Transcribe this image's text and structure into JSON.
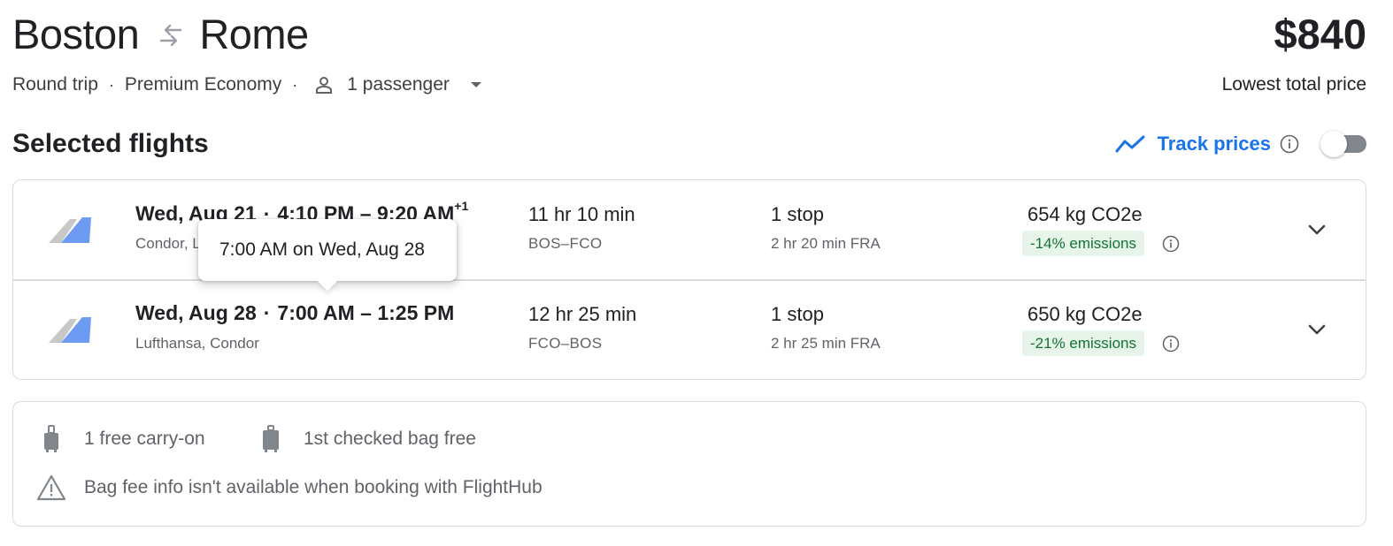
{
  "header": {
    "origin": "Boston",
    "destination": "Rome",
    "price": "$840",
    "price_caption": "Lowest total price",
    "trip_type": "Round trip",
    "cabin": "Premium Economy",
    "passengers": "1 passenger",
    "separator": "·"
  },
  "section": {
    "title": "Selected flights",
    "track_prices_label": "Track prices",
    "track_prices_enabled": false
  },
  "flights": [
    {
      "date": "Wed, Aug 21",
      "depart": "4:10 PM",
      "dash": "–",
      "arrive": "9:20 AM",
      "day_offset": "+1",
      "airlines": "Condor, Lufthansa",
      "duration": "11 hr 10 min",
      "route": "BOS–FCO",
      "stops": "1 stop",
      "layover": "2 hr 20 min FRA",
      "co2": "654 kg CO2e",
      "emissions": "-14% emissions"
    },
    {
      "date": "Wed, Aug 28",
      "depart": "7:00 AM",
      "dash": "–",
      "arrive": "1:25 PM",
      "day_offset": "",
      "airlines": "Lufthansa, Condor",
      "duration": "12 hr 25 min",
      "route": "FCO–BOS",
      "stops": "1 stop",
      "layover": "2 hr 25 min FRA",
      "co2": "650 kg CO2e",
      "emissions": "-21% emissions"
    }
  ],
  "tooltip": {
    "text": "7:00 AM on Wed, Aug 28"
  },
  "bags": {
    "carry_on": "1 free carry-on",
    "checked": "1st checked bag free",
    "notice": "Bag fee info isn't available when booking with FlightHub"
  },
  "colors": {
    "accent": "#1a73e8",
    "emissions_bg": "#e6f4ea",
    "emissions_text": "#137333",
    "border": "#dadce0"
  },
  "icons": {
    "swap": "swap-arrows-icon",
    "person": "person-icon",
    "dropdown": "caret-down-icon",
    "trend": "trending-line-icon",
    "info": "info-icon",
    "airline_logo": "airline-tail-logo",
    "expand": "chevron-down-icon",
    "carry_on": "carry-on-bag-icon",
    "checked_bag": "checked-bag-icon",
    "warning": "warning-triangle-icon"
  }
}
